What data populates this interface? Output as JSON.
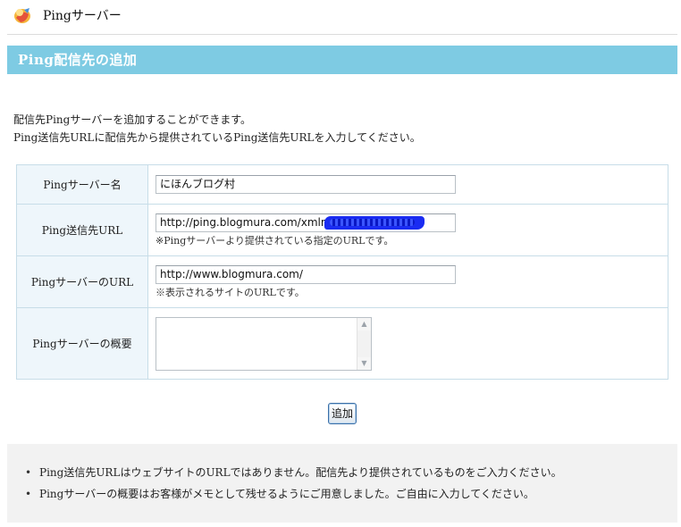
{
  "header": {
    "title": "Pingサーバー",
    "icon": "ping-server-icon"
  },
  "section": {
    "title": "Ping配信先の追加",
    "bar_color": "#7ecbe3"
  },
  "intro": [
    "配信先Pingサーバーを追加することができます。",
    "Ping送信先URLに配信先から提供されているPing送信先URLを入力してください。"
  ],
  "form": {
    "server_name": {
      "label": "Pingサーバー名",
      "value": "にほんブログ村"
    },
    "ping_url": {
      "label": "Ping送信先URL",
      "value": "http://ping.blogmura.com/xmlrpc/",
      "note": "※Pingサーバーより提供されている指定のURLです。"
    },
    "server_url": {
      "label": "PingサーバーのURL",
      "value": "http://www.blogmura.com/",
      "note": "※表示されるサイトのURLです。"
    },
    "summary": {
      "label": "Pingサーバーの概要",
      "value": ""
    }
  },
  "buttons": {
    "add_label": "追加"
  },
  "info": [
    "Ping送信先URLはウェブサイトのURLではありません。配信先より提供されているものをご入力ください。",
    "Pingサーバーの概要はお客様がメモとして残せるようにご用意しました。ご自由に入力してください。"
  ]
}
